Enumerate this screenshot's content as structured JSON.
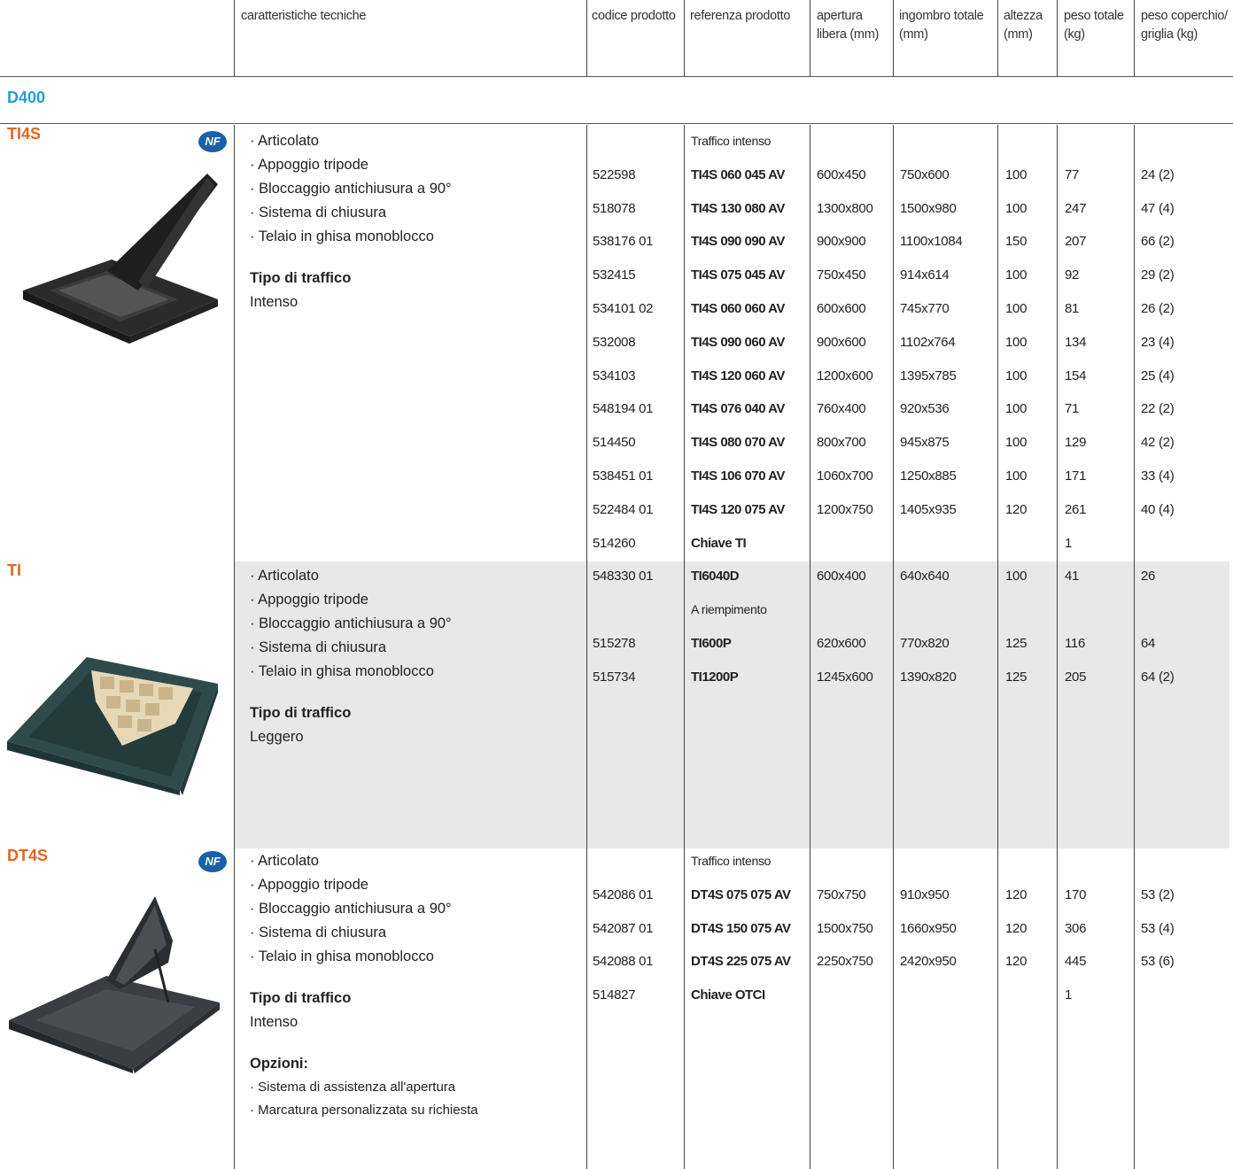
{
  "header": {
    "col_features": "caratteristiche tecniche",
    "col_code": "codice prodotto",
    "col_ref": "referenza prodotto",
    "col_opening": "apertura libera (mm)",
    "col_overall": "ingombro totale (mm)",
    "col_height": "altezza (mm)",
    "col_weight": "peso totale (kg)",
    "col_cover": "peso coperchio/ griglia (kg)"
  },
  "grade": "D400",
  "nf_mark": "NF",
  "sections": [
    {
      "title": "TI4S",
      "features": [
        "· Articolato",
        "· Appoggio tripode",
        "· Bloccaggio antichiusura a 90°",
        "· Sistema di chiusura",
        "· Telaio in ghisa monoblocco"
      ],
      "traffic_label": "Tipo di traffico",
      "traffic_value": "Intenso",
      "rows": [
        {
          "code": "",
          "ref": "Traffico intenso",
          "sub": true,
          "opening": "",
          "overall": "",
          "height": "",
          "weight": "",
          "cover": ""
        },
        {
          "code": "522598",
          "ref": "TI4S 060 045 AV",
          "opening": "600x450",
          "overall": "750x600",
          "height": "100",
          "weight": "77",
          "cover": "24 (2)"
        },
        {
          "code": "518078",
          "ref": "TI4S 130 080 AV",
          "opening": "1300x800",
          "overall": "1500x980",
          "height": "100",
          "weight": "247",
          "cover": "47 (4)"
        },
        {
          "code": "538176 01",
          "ref": "TI4S 090 090 AV",
          "opening": "900x900",
          "overall": "1100x1084",
          "height": "150",
          "weight": "207",
          "cover": "66 (2)"
        },
        {
          "code": "532415",
          "ref": "TI4S 075 045 AV",
          "opening": "750x450",
          "overall": "914x614",
          "height": "100",
          "weight": "92",
          "cover": "29 (2)"
        },
        {
          "code": "534101 02",
          "ref": "TI4S 060 060 AV",
          "opening": "600x600",
          "overall": "745x770",
          "height": "100",
          "weight": "81",
          "cover": "26 (2)"
        },
        {
          "code": "532008",
          "ref": "TI4S 090 060 AV",
          "opening": "900x600",
          "overall": "1102x764",
          "height": "100",
          "weight": "134",
          "cover": "23 (4)"
        },
        {
          "code": "534103",
          "ref": "TI4S 120 060 AV",
          "opening": "1200x600",
          "overall": "1395x785",
          "height": "100",
          "weight": "154",
          "cover": "25 (4)"
        },
        {
          "code": "548194 01",
          "ref": "TI4S 076 040 AV",
          "opening": "760x400",
          "overall": "920x536",
          "height": "100",
          "weight": "71",
          "cover": "22 (2)"
        },
        {
          "code": "514450",
          "ref": "TI4S 080 070 AV",
          "opening": "800x700",
          "overall": "945x875",
          "height": "100",
          "weight": "129",
          "cover": "42 (2)"
        },
        {
          "code": "538451 01",
          "ref": "TI4S 106 070 AV",
          "opening": "1060x700",
          "overall": "1250x885",
          "height": "100",
          "weight": "171",
          "cover": "33 (4)"
        },
        {
          "code": "522484 01",
          "ref": "TI4S 120 075 AV",
          "opening": "1200x750",
          "overall": "1405x935",
          "height": "120",
          "weight": "261",
          "cover": "40 (4)"
        },
        {
          "code": "514260",
          "ref": "Chiave TI",
          "opening": "",
          "overall": "",
          "height": "",
          "weight": "1",
          "cover": ""
        }
      ]
    },
    {
      "title": "TI",
      "features": [
        "· Articolato",
        "· Appoggio tripode",
        "· Bloccaggio antichiusura a 90°",
        "· Sistema di chiusura",
        "· Telaio in ghisa monoblocco"
      ],
      "traffic_label": "Tipo di traffico",
      "traffic_value": "Leggero",
      "rows": [
        {
          "code": "548330 01",
          "ref": "TI6040D",
          "opening": "600x400",
          "overall": "640x640",
          "height": "100",
          "weight": "41",
          "cover": "26"
        },
        {
          "code": "",
          "ref": "A riempimento",
          "sub": true,
          "opening": "",
          "overall": "",
          "height": "",
          "weight": "",
          "cover": ""
        },
        {
          "code": "515278",
          "ref": "TI600P",
          "opening": "620x600",
          "overall": "770x820",
          "height": "125",
          "weight": "116",
          "cover": "64"
        },
        {
          "code": "515734",
          "ref": "TI1200P",
          "opening": "1245x600",
          "overall": "1390x820",
          "height": "125",
          "weight": "205",
          "cover": "64 (2)"
        }
      ]
    },
    {
      "title": "DT4S",
      "features": [
        "· Articolato",
        "· Appoggio tripode",
        "· Bloccaggio antichiusura a 90°",
        "· Sistema di chiusura",
        "· Telaio in ghisa monoblocco"
      ],
      "traffic_label": "Tipo di traffico",
      "traffic_value": "Intenso",
      "options_label": "Opzioni:",
      "options": [
        "· Sistema di assistenza all'apertura",
        "· Marcatura personalizzata su richiesta"
      ],
      "rows": [
        {
          "code": "",
          "ref": "Traffico intenso",
          "sub": true,
          "opening": "",
          "overall": "",
          "height": "",
          "weight": "",
          "cover": ""
        },
        {
          "code": "542086 01",
          "ref": "DT4S 075 075 AV",
          "opening": "750x750",
          "overall": "910x950",
          "height": "120",
          "weight": "170",
          "cover": "53 (2)"
        },
        {
          "code": "542087 01",
          "ref": "DT4S 150 075 AV",
          "opening": "1500x750",
          "overall": "1660x950",
          "height": "120",
          "weight": "306",
          "cover": "53 (4)"
        },
        {
          "code": "542088 01",
          "ref": "DT4S 225 075 AV",
          "opening": "2250x750",
          "overall": "2420x950",
          "height": "120",
          "weight": "445",
          "cover": "53 (6)"
        },
        {
          "code": "514827",
          "ref": "Chiave OTCI",
          "opening": "",
          "overall": "",
          "height": "",
          "weight": "1",
          "cover": ""
        }
      ]
    }
  ]
}
